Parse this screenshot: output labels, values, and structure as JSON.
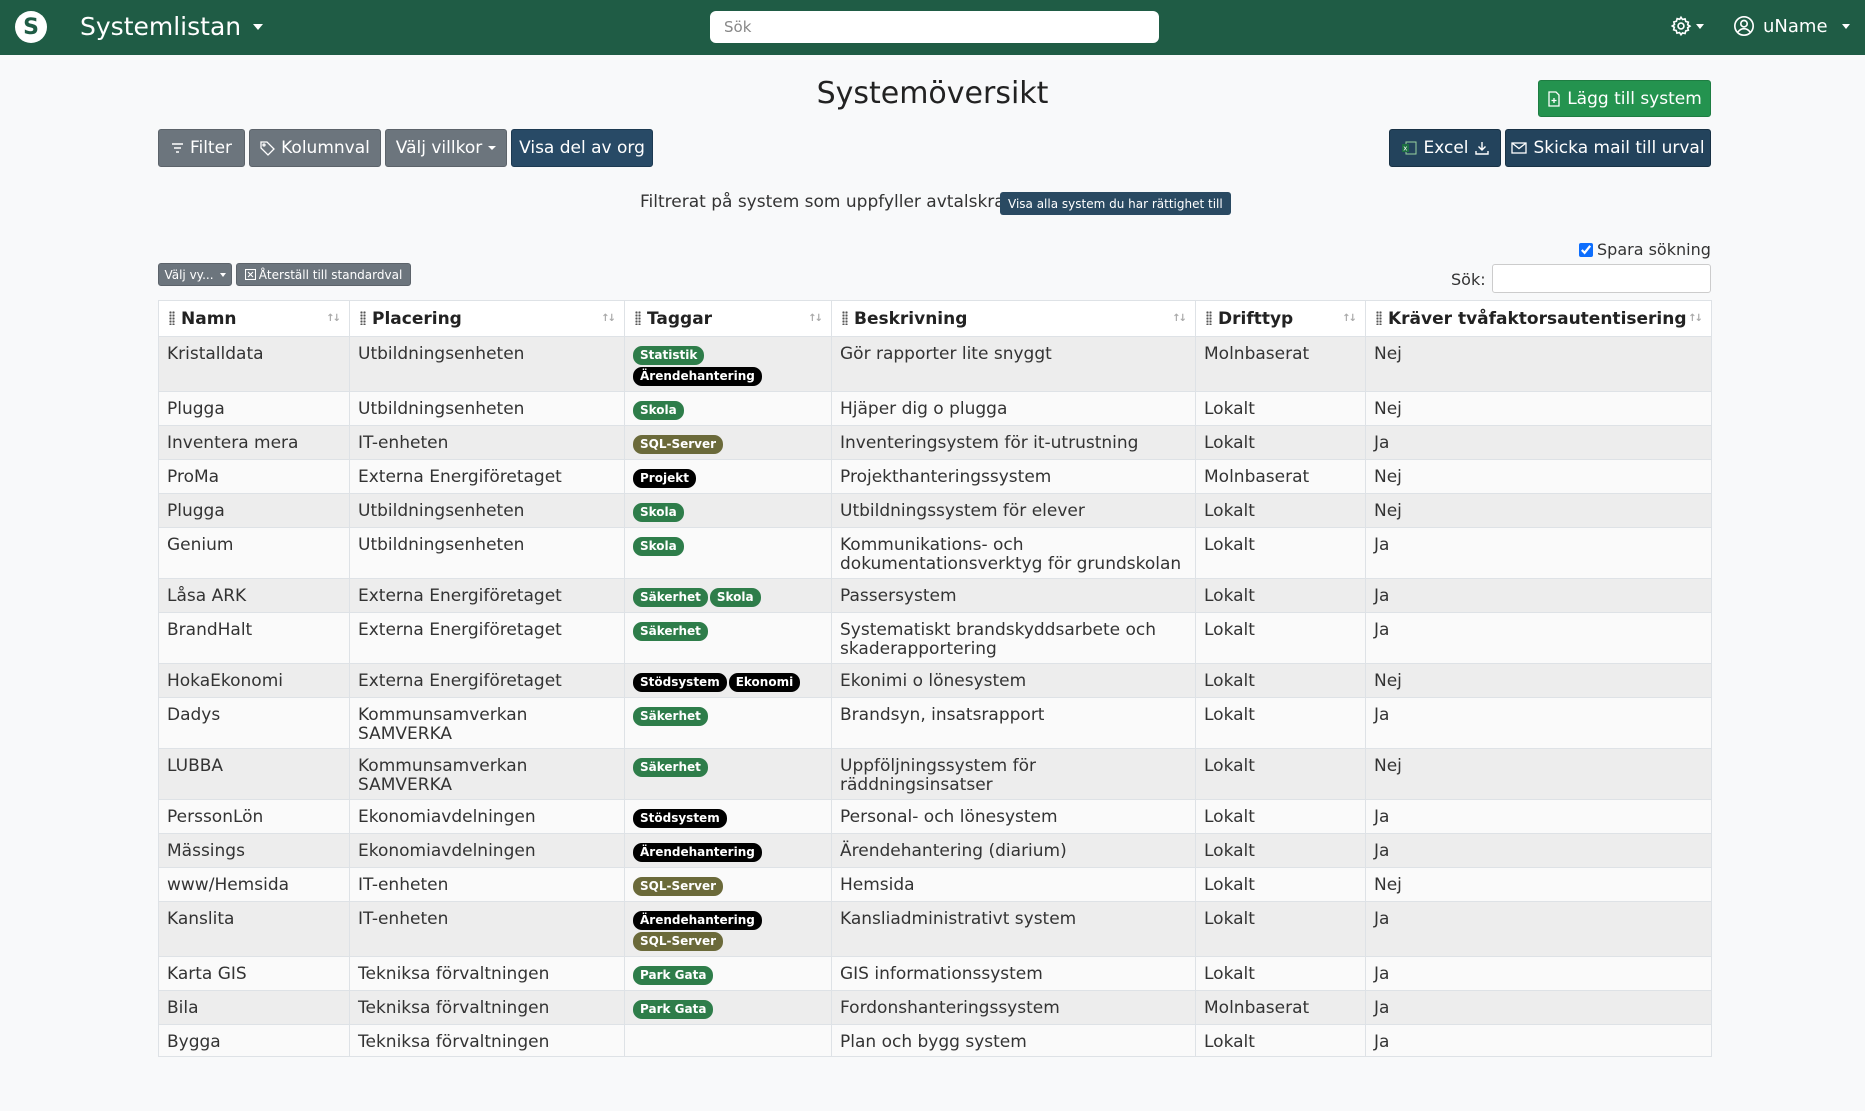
{
  "navbar": {
    "logo_letter": "S",
    "app_title": "Systemlistan",
    "search_placeholder": "Sök",
    "user_name": "uName"
  },
  "page": {
    "title": "Systemöversikt",
    "add_system_label": "Lägg till system"
  },
  "toolbar": {
    "filter_label": "Filter",
    "columns_label": "Kolumnval",
    "conditions_label": "Välj villkor",
    "org_part_label": "Visa del av org",
    "excel_label": "Excel",
    "mail_label": "Skicka mail till urval"
  },
  "filter_notice": {
    "text": "Filtrerat på system som uppfyller avtalskrav",
    "show_all_label": "Visa alla system du har rättighet till"
  },
  "view_controls": {
    "choose_view_label": "Välj vy...",
    "reset_label": "Återställ till standardval",
    "save_search_label": "Spara sökning",
    "save_search_checked": true,
    "search_label": "Sök:"
  },
  "tag_colors": {
    "Statistik": "#2e7d4a",
    "Ärendehantering": "#000000",
    "Skola": "#2e7d4a",
    "SQL-Server": "#6b6a3a",
    "Projekt": "#000000",
    "Säkerhet": "#2e7d4a",
    "Stödsystem": "#000000",
    "Ekonomi": "#000000",
    "Park Gata": "#2e7d4a"
  },
  "table": {
    "columns": [
      "Namn",
      "Placering",
      "Taggar",
      "Beskrivning",
      "Drifttyp",
      "Kräver tvåfaktorsautentisering"
    ],
    "rows": [
      {
        "name": "Kristalldata",
        "place": "Utbildningsenheten",
        "tags": [
          "Statistik",
          "Ärendehantering"
        ],
        "desc": "Gör rapporter lite snyggt",
        "drift": "Molnbaserat",
        "twofa": "Nej"
      },
      {
        "name": "Plugga",
        "place": "Utbildningsenheten",
        "tags": [
          "Skola"
        ],
        "desc": "Hjäper dig o plugga",
        "drift": "Lokalt",
        "twofa": "Nej"
      },
      {
        "name": "Inventera mera",
        "place": "IT-enheten",
        "tags": [
          "SQL-Server"
        ],
        "desc": "Inventeringsystem för it-utrustning",
        "drift": "Lokalt",
        "twofa": "Ja"
      },
      {
        "name": "ProMa",
        "place": "Externa Energiföretaget",
        "tags": [
          "Projekt"
        ],
        "desc": "Projekthanteringssystem",
        "drift": "Molnbaserat",
        "twofa": "Nej"
      },
      {
        "name": "Plugga",
        "place": "Utbildningsenheten",
        "tags": [
          "Skola"
        ],
        "desc": "Utbildningssystem för elever",
        "drift": "Lokalt",
        "twofa": "Nej"
      },
      {
        "name": "Genium",
        "place": "Utbildningsenheten",
        "tags": [
          "Skola"
        ],
        "desc": "Kommunikations- och dokumentationsverktyg för grundskolan",
        "drift": "Lokalt",
        "twofa": "Ja"
      },
      {
        "name": "Låsa ARK",
        "place": "Externa Energiföretaget",
        "tags": [
          "Säkerhet",
          "Skola"
        ],
        "desc": "Passersystem",
        "drift": "Lokalt",
        "twofa": "Ja"
      },
      {
        "name": "BrandHalt",
        "place": "Externa Energiföretaget",
        "tags": [
          "Säkerhet"
        ],
        "desc": "Systematiskt brandskyddsarbete och skaderapportering",
        "drift": "Lokalt",
        "twofa": "Ja"
      },
      {
        "name": "HokaEkonomi",
        "place": "Externa Energiföretaget",
        "tags": [
          "Stödsystem",
          "Ekonomi"
        ],
        "desc": "Ekonimi o lönesystem",
        "drift": "Lokalt",
        "twofa": "Nej"
      },
      {
        "name": "Dadys",
        "place": "Kommunsamverkan SAMVERKA",
        "tags": [
          "Säkerhet"
        ],
        "desc": "Brandsyn, insatsrapport",
        "drift": "Lokalt",
        "twofa": "Ja"
      },
      {
        "name": "LUBBA",
        "place": "Kommunsamverkan SAMVERKA",
        "tags": [
          "Säkerhet"
        ],
        "desc": "Uppföljningssystem för räddningsinsatser",
        "drift": "Lokalt",
        "twofa": "Nej"
      },
      {
        "name": "PerssonLön",
        "place": "Ekonomiavdelningen",
        "tags": [
          "Stödsystem"
        ],
        "desc": "Personal- och lönesystem",
        "drift": "Lokalt",
        "twofa": "Ja"
      },
      {
        "name": "Mässings",
        "place": "Ekonomiavdelningen",
        "tags": [
          "Ärendehantering"
        ],
        "desc": "Ärendehantering (diarium)",
        "drift": "Lokalt",
        "twofa": "Ja"
      },
      {
        "name": "www/Hemsida",
        "place": "IT-enheten",
        "tags": [
          "SQL-Server"
        ],
        "desc": "Hemsida",
        "drift": "Lokalt",
        "twofa": "Nej"
      },
      {
        "name": "Kanslita",
        "place": "IT-enheten",
        "tags": [
          "Ärendehantering",
          "SQL-Server"
        ],
        "desc": "Kansliadministrativt system",
        "drift": "Lokalt",
        "twofa": "Ja"
      },
      {
        "name": "Karta GIS",
        "place": "Tekniksa förvaltningen",
        "tags": [
          "Park Gata"
        ],
        "desc": "GIS informationssystem",
        "drift": "Lokalt",
        "twofa": "Ja"
      },
      {
        "name": "Bila",
        "place": "Tekniksa förvaltningen",
        "tags": [
          "Park Gata"
        ],
        "desc": "Fordonshanteringssystem",
        "drift": "Molnbaserat",
        "twofa": "Ja"
      },
      {
        "name": "Bygga",
        "place": "Tekniksa förvaltningen",
        "tags": [],
        "desc": "Plan och bygg system",
        "drift": "Lokalt",
        "twofa": "Ja"
      }
    ]
  }
}
